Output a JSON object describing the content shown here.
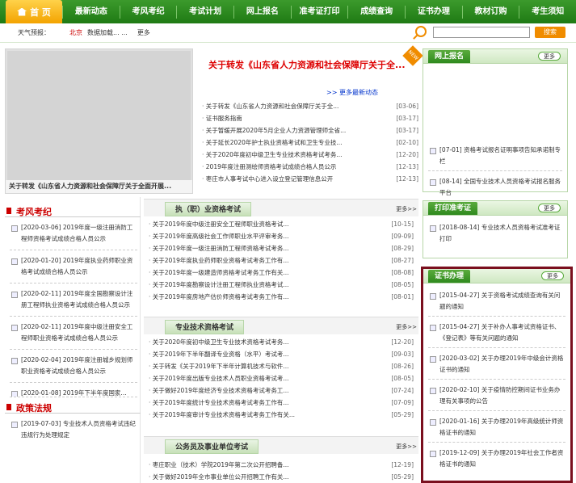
{
  "nav": {
    "home": "首 页",
    "items": [
      "最新动态",
      "考风考纪",
      "考试计划",
      "网上报名",
      "准考证打印",
      "成绩查询",
      "证书办理",
      "教材订购",
      "考生须知"
    ]
  },
  "weather": {
    "label": "天气预报：",
    "city": "北京",
    "loading": "数据加载... ...",
    "more": "更多",
    "search_button": "搜索"
  },
  "slideshow": {
    "caption": "关于转发《山东省人力资源和社会保障厅关于全面开展..."
  },
  "headline": {
    "title": "关于转发《山东省人力资源和社会保障厅关于全...",
    "badge": "NEW",
    "more": ">> 更多最新动态"
  },
  "news": [
    {
      "t": "关于转发《山东省人力资源和社会保障厅关于全...",
      "d": "[03-06]"
    },
    {
      "t": "证书服务指南",
      "d": "[03-17]"
    },
    {
      "t": "关于暂缓开展2020年5月企业人力资源管理师全省...",
      "d": "[03-17]"
    },
    {
      "t": "关于延长2020年护士执业资格考试和卫生专业技...",
      "d": "[02-10]"
    },
    {
      "t": "关于2020年度初中级卫生专业技术资格考试考务...",
      "d": "[12-20]"
    },
    {
      "t": "2019年度注册测绘师资格考试成绩合格人员公示",
      "d": "[12-13]"
    },
    {
      "t": "枣庄市人事考试中心进入设立登记管理信息公开",
      "d": "[12-13]"
    }
  ],
  "online": {
    "title": "网上报名",
    "more": "更多",
    "items": [
      {
        "d": "[07-01]",
        "t": "资格考试报名证明事项告知承诺制专栏"
      },
      {
        "d": "[08-14]",
        "t": "全国专业技术人员资格考试报名服务平台"
      }
    ]
  },
  "ticket": {
    "title": "打印准考证",
    "more": "更多",
    "items": [
      {
        "d": "[2018-08-14]",
        "t": "专业技术人员资格考试准考证打印"
      }
    ]
  },
  "cert": {
    "title": "证书办理",
    "more": "更多",
    "items": [
      {
        "d": "[2015-04-27]",
        "t": "关于资格考试成绩查询有关问题的通知"
      },
      {
        "d": "[2015-04-27]",
        "t": "关于补办人事考试资格证书、《登记表》等有关问题的通知"
      },
      {
        "d": "[2020-03-02]",
        "t": "关于办理2019年中级会计资格证书的通知"
      },
      {
        "d": "[2020-02-10]",
        "t": "关于疫情防控期间证书业务办理有关事项的公告"
      },
      {
        "d": "[2020-01-16]",
        "t": "关于办理2019年高级统计师资格证书的通知"
      },
      {
        "d": "[2019-12-09]",
        "t": "关于办理2019年社会工作者资格证书的通知"
      }
    ]
  },
  "kf": {
    "title": "考风考纪",
    "items": [
      {
        "d": "[2020-03-06]",
        "t": "2019年度一级注册消防工程师资格考试成绩合格人员公示"
      },
      {
        "d": "[2020-01-20]",
        "t": "2019年度执业药师职业资格考试成绩合格人员公示"
      },
      {
        "d": "[2020-02-11]",
        "t": "2019年度全国勘察设计注册工程师执业资格考试成绩合格人员公示"
      },
      {
        "d": "[2020-02-11]",
        "t": "2019年度中级注册安全工程师职业资格考试成绩合格人员公示"
      },
      {
        "d": "[2020-02-04]",
        "t": "2019年度注册城乡规划师职业资格考试成绩合格人员公示"
      },
      {
        "d": "[2020-01-08]",
        "t": "2019年下半年度国家..."
      }
    ]
  },
  "policy": {
    "title": "政策法规",
    "items": [
      {
        "d": "[2019-07-03]",
        "t": "专业技术人员资格考试违纪违规行为处理规定"
      }
    ]
  },
  "sec1": {
    "title": "执（职）业资格考试",
    "more": "更多>>",
    "rows": [
      {
        "t": "关于2019年度中级注册安全工程师职业资格考试...",
        "d": "[10-15]"
      },
      {
        "t": "关于2019年度高级社会工作师职业水平评审考务...",
        "d": "[09-09]"
      },
      {
        "t": "关于2019年度一级注册消防工程师资格考试考务...",
        "d": "[08-29]"
      },
      {
        "t": "关于2019年度执业药师职业资格考试考务工作有...",
        "d": "[08-27]"
      },
      {
        "t": "关于2019年度一级建造师资格考试考务工作有关...",
        "d": "[08-08]"
      },
      {
        "t": "关于2019年度勘察设计注册工程师执业资格考试...",
        "d": "[08-05]"
      },
      {
        "t": "关于2019年度房地产估价师资格考试考务工作有...",
        "d": "[08-01]"
      }
    ]
  },
  "sec2": {
    "title": "专业技术资格考试",
    "more": "更多>>",
    "rows": [
      {
        "t": "关于2020年度初中级卫生专业技术资格考试考务...",
        "d": "[12-20]"
      },
      {
        "t": "关于2019年下半年翻译专业资格（水平）考试考...",
        "d": "[09-03]"
      },
      {
        "t": "关于转发《关于2019年下半年计算机技术与软件...",
        "d": "[08-26]"
      },
      {
        "t": "关于2019年度出版专业技术人员职业资格考试考...",
        "d": "[08-05]"
      },
      {
        "t": "关于做好2019年度经济专业技术资格考试考务工...",
        "d": "[07-24]"
      },
      {
        "t": "关于2019年度统计专业技术资格考试考务工作有...",
        "d": "[07-09]"
      },
      {
        "t": "关于2019年度审计专业技术资格考试考务工作有关...",
        "d": "[05-29]"
      }
    ]
  },
  "sec3": {
    "title": "公务员及事业单位考试",
    "more": "更多>>",
    "rows": [
      {
        "t": "枣庄职业（技术）学院2019年第二次公开招聘备...",
        "d": "[12-19]"
      },
      {
        "t": "关于做好2019年全市事业单位公开招聘工作有关...",
        "d": "[05-29]"
      }
    ]
  }
}
